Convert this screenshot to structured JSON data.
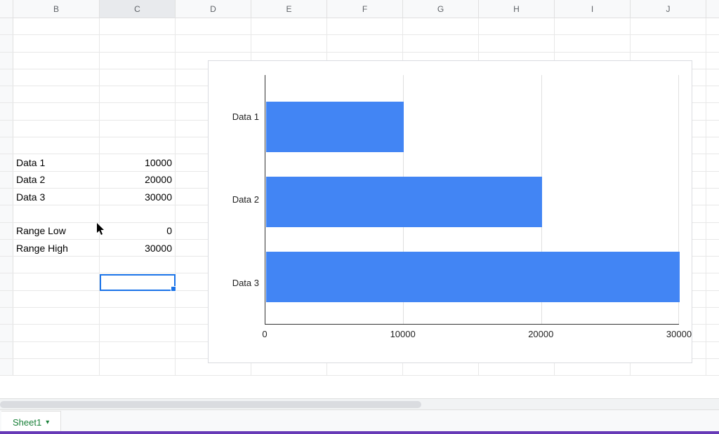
{
  "columns": [
    "B",
    "C",
    "D",
    "E",
    "F",
    "G",
    "H",
    "I",
    "J"
  ],
  "selected_column": "C",
  "cells": {
    "data1_label": "Data 1",
    "data1_value": "10000",
    "data2_label": "Data 2",
    "data2_value": "20000",
    "data3_label": "Data 3",
    "data3_value": "30000",
    "range_low_label": "Range Low",
    "range_low_value": "0",
    "range_high_label": "Range High",
    "range_high_value": "30000"
  },
  "chart_data": {
    "type": "bar",
    "orientation": "horizontal",
    "categories": [
      "Data 1",
      "Data 2",
      "Data 3"
    ],
    "values": [
      10000,
      20000,
      30000
    ],
    "xlim": [
      0,
      30000
    ],
    "xticks": [
      0,
      10000,
      20000,
      30000
    ]
  },
  "sheet_tab": "Sheet1"
}
